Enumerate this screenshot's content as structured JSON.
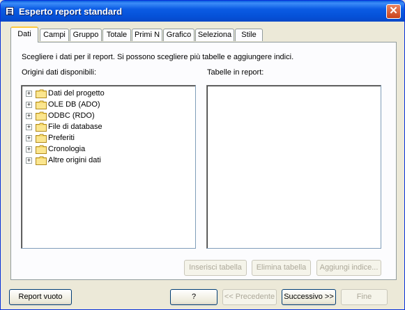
{
  "window": {
    "title": "Esperto report standard"
  },
  "tabs": [
    {
      "label": "Dati",
      "active": true
    },
    {
      "label": "Campi"
    },
    {
      "label": "Gruppo"
    },
    {
      "label": "Totale"
    },
    {
      "label": "Primi N"
    },
    {
      "label": "Grafico"
    },
    {
      "label": "Seleziona"
    },
    {
      "label": "Stile"
    }
  ],
  "panel": {
    "instruction": "Scegliere i dati per il report. Si possono scegliere più tabelle e aggiungere indici.",
    "available_label": "Origini dati disponibili:",
    "report_tables_label": "Tabelle in report:",
    "tree_items": [
      {
        "label": "Dati del progetto",
        "expander": "+",
        "icon": "folder-icon"
      },
      {
        "label": "OLE DB (ADO)",
        "expander": "+",
        "icon": "folder-icon"
      },
      {
        "label": "ODBC (RDO)",
        "expander": "+",
        "icon": "folder-icon"
      },
      {
        "label": "File di database",
        "expander": "+",
        "icon": "folder-icon"
      },
      {
        "label": "Preferiti",
        "expander": "+",
        "icon": "folder-icon"
      },
      {
        "label": "Cronologia",
        "expander": "+",
        "icon": "folder-icon"
      },
      {
        "label": "Altre origini dati",
        "expander": "+",
        "icon": "folder-icon"
      }
    ],
    "table_buttons": {
      "insert": "Inserisci tabella",
      "remove": "Elimina tabella",
      "add_index": "Aggiungi indice..."
    }
  },
  "footer": {
    "blank_report": "Report vuoto",
    "help": "?",
    "back": "<< Precedente",
    "next": "Successivo >>",
    "finish": "Fine"
  }
}
